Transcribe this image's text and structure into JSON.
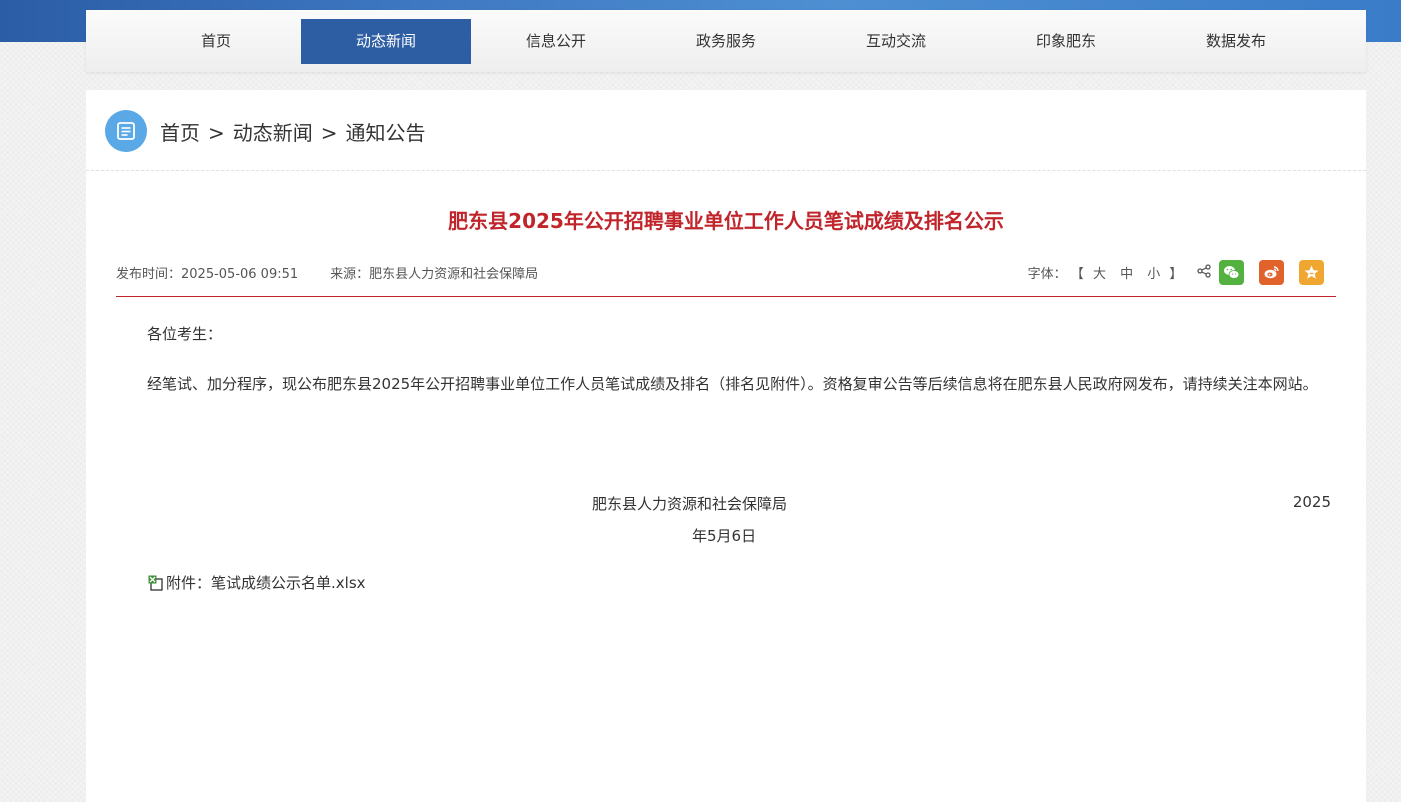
{
  "nav": {
    "items": [
      {
        "label": "首页"
      },
      {
        "label": "动态新闻",
        "active": true
      },
      {
        "label": "信息公开"
      },
      {
        "label": "政务服务"
      },
      {
        "label": "互动交流"
      },
      {
        "label": "印象肥东"
      },
      {
        "label": "数据发布"
      }
    ]
  },
  "breadcrumb": {
    "home": "首页",
    "sep": ">",
    "section": "动态新闻",
    "current": "通知公告"
  },
  "article": {
    "title": "肥东县2025年公开招聘事业单位工作人员笔试成绩及排名公示",
    "publish_time": "发布时间：2025-05-06 09:51",
    "source": "来源：肥东县人力资源和社会保障局",
    "greeting": "各位考生：",
    "paragraph": "经笔试、加分程序，现公布肥东县2025年公开招聘事业单位工作人员笔试成绩及排名（排名见附件）。资格复审公告等后续信息将在肥东县人民政府网发布，请持续关注本网站。",
    "signature_org": "肥东县人力资源和社会保障局",
    "signature_year": "2025",
    "signature_date": "年5月6日",
    "attachment": "附件：笔试成绩公示名单.xlsx"
  },
  "tools": {
    "font_label": "字体：",
    "bracket_open": "【",
    "bracket_close": "】",
    "size_large": "大",
    "size_medium": "中",
    "size_small": "小",
    "icons": [
      "share-icon",
      "wechat-icon",
      "weibo-icon",
      "favorite-icon"
    ]
  },
  "colors": {
    "nav_active": "#2d5ea3",
    "title": "#c0252b",
    "wechat": "#52b13f",
    "weibo": "#e2622c",
    "favorite": "#f0a732"
  }
}
